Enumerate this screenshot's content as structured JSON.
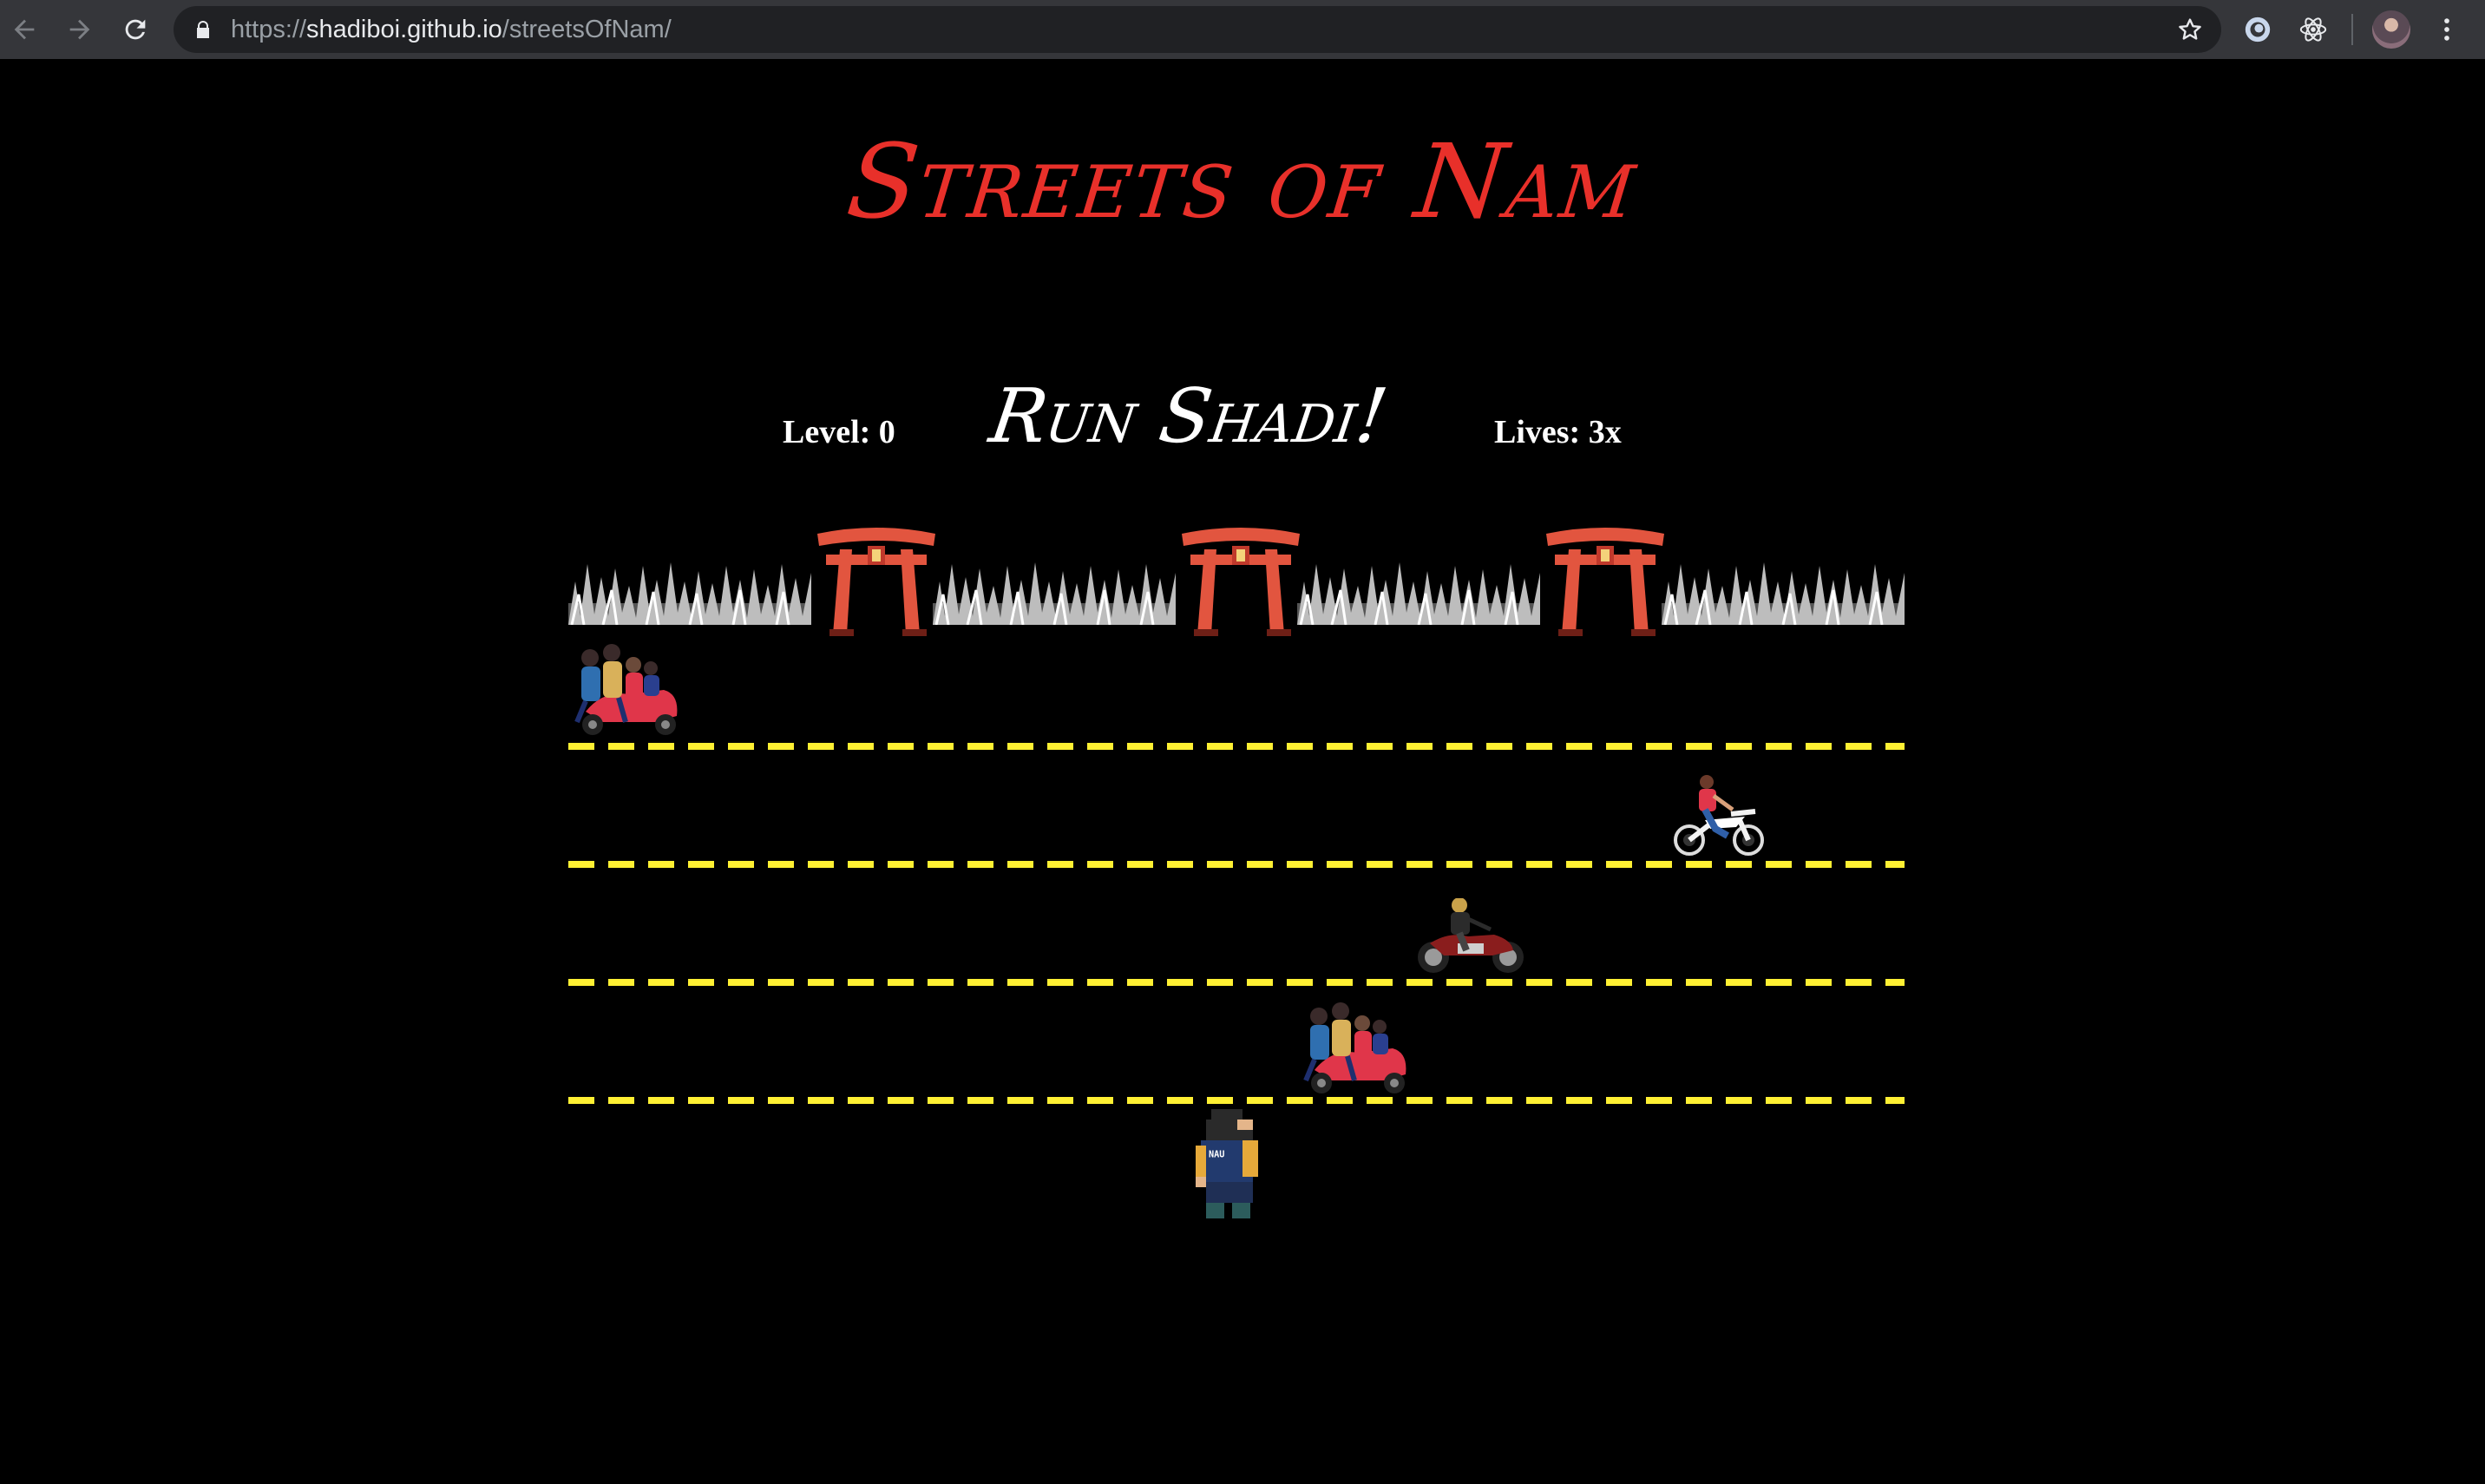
{
  "browser": {
    "url_protocol": "https://",
    "url_host": "shadiboi.github.io",
    "url_path": "/streetsOfNam/",
    "icons": [
      "back-icon",
      "forward-icon",
      "reload-icon",
      "lock-icon",
      "bookmark-star-icon",
      "extension-icon",
      "react-devtools-icon",
      "profile-avatar"
    ]
  },
  "game": {
    "title": "Streets of Nam",
    "level_label": "Level: 0",
    "subtitle": "Run Shadi!",
    "lives_label": "Lives: 3x",
    "colors": {
      "title": "#e8302a",
      "lane_lines": "#fff033",
      "background": "#000000"
    },
    "scenery": [
      "grass",
      "torii-gate",
      "grass",
      "torii-gate",
      "grass",
      "torii-gate",
      "grass"
    ],
    "lanes": [
      {
        "vehicle": "scooter-with-family",
        "direction": "left"
      },
      {
        "vehicle": "dirt-bike-rider",
        "direction": "right"
      },
      {
        "vehicle": "motorcycle-rider",
        "direction": "right"
      },
      {
        "vehicle": "scooter-with-family",
        "direction": "left"
      }
    ],
    "player": {
      "sprite": "pixel-character",
      "shirt_text": "NAU"
    }
  }
}
